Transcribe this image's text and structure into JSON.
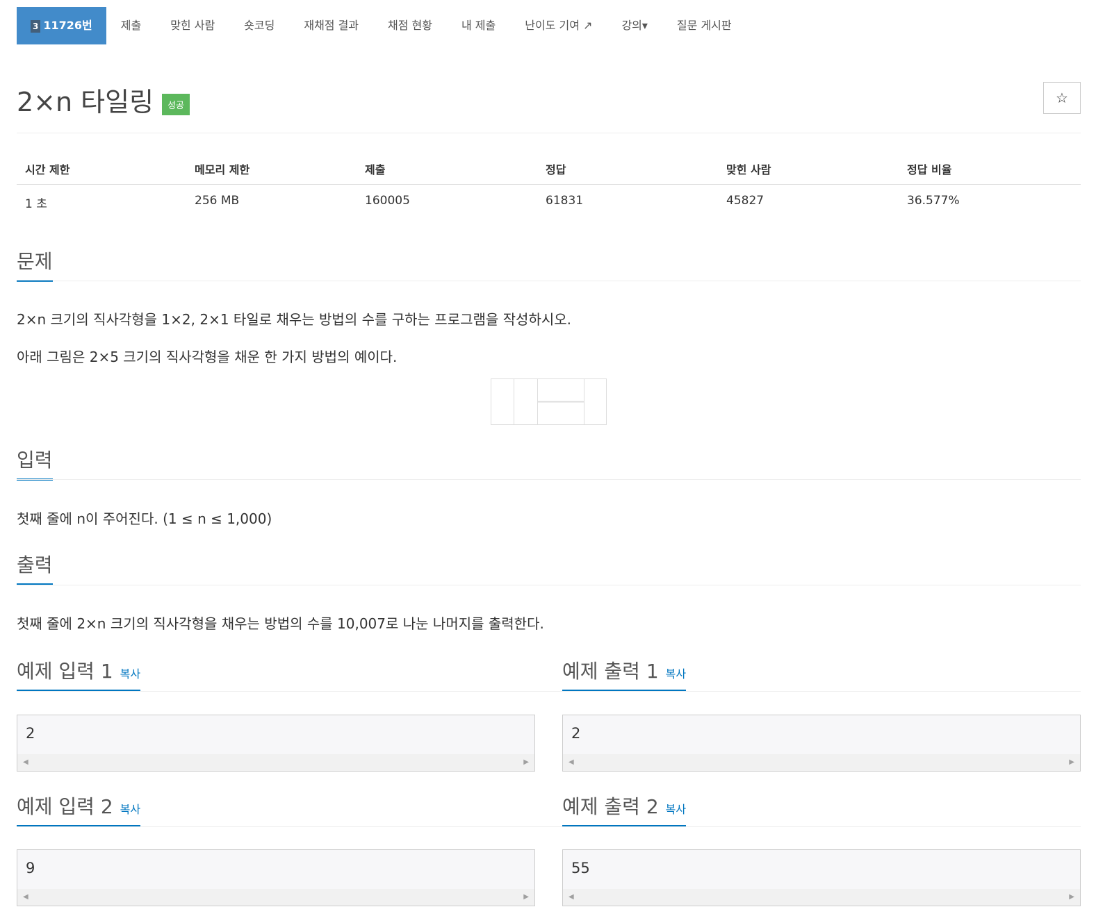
{
  "nav": {
    "problem_id": "11726번",
    "tier": "3",
    "items": [
      "제출",
      "맞힌 사람",
      "숏코딩",
      "재채점 결과",
      "채점 현황",
      "내 제출",
      "난이도 기여 ↗",
      "강의▾",
      "질문 게시판"
    ]
  },
  "title": "2×n 타일링",
  "badge": "성공",
  "star": "☆",
  "stats": {
    "headers": [
      "시간 제한",
      "메모리 제한",
      "제출",
      "정답",
      "맞힌 사람",
      "정답 비율"
    ],
    "values": [
      "1 초",
      "256 MB",
      "160005",
      "61831",
      "45827",
      "36.577%"
    ]
  },
  "problem": {
    "heading": "문제",
    "lines": [
      "2×n 크기의 직사각형을 1×2, 2×1 타일로 채우는 방법의 수를 구하는 프로그램을 작성하시오.",
      "아래 그림은 2×5 크기의 직사각형을 채운 한 가지 방법의 예이다."
    ]
  },
  "input": {
    "heading": "입력",
    "text": "첫째 줄에 n이 주어진다. (1 ≤ n ≤ 1,000)"
  },
  "output": {
    "heading": "출력",
    "text": "첫째 줄에 2×n 크기의 직사각형을 채우는 방법의 수를 10,007로 나눈 나머지를 출력한다."
  },
  "copy": "복사",
  "samples": [
    {
      "in_title": "예제 입력 1",
      "out_title": "예제 출력 1",
      "input": "2",
      "output": "2"
    },
    {
      "in_title": "예제 입력 2",
      "out_title": "예제 출력 2",
      "input": "9",
      "output": "55"
    }
  ]
}
